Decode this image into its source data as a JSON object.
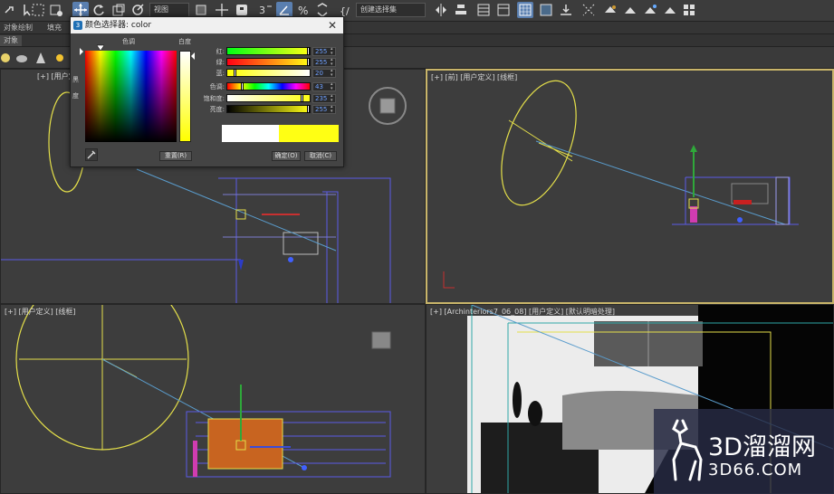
{
  "toolbar": {
    "view_dropdown": "视图",
    "selection_set_dropdown": "创建选择集"
  },
  "tabs": {
    "object_paint": "对象绘制",
    "populate": "填充",
    "objects": "对象"
  },
  "viewports": {
    "top_left": {
      "label": "[+] [用户定义] [线框]"
    },
    "front_right": {
      "label": "[+] [前] [用户定义] [线框]"
    },
    "left_bottom": {
      "label": "[+] [用户定义] [线框]"
    },
    "camera": {
      "label": "[+] [Archinteriors7_06_08] [用户定义] [默认明暗处理]"
    }
  },
  "color_dialog": {
    "title": "颜色选择器: color",
    "hue_label": "色调",
    "whiteness_label": "白度",
    "black_label": "黑",
    "degree_label": "度",
    "sliders": [
      {
        "label": "红:",
        "value": "255",
        "fraction": 1.0
      },
      {
        "label": "绿:",
        "value": "255",
        "fraction": 1.0
      },
      {
        "label": "蓝:",
        "value": "20",
        "fraction": 0.078
      },
      {
        "label": "色调:",
        "value": "43",
        "fraction": 0.169
      },
      {
        "label": "饱和度:",
        "value": "235",
        "fraction": 0.922
      },
      {
        "label": "亮度:",
        "value": "255",
        "fraction": 1.0
      }
    ],
    "reset_button": "重置(R)",
    "ok_button": "确定(O)",
    "cancel_button": "取消(C)",
    "old_color": "#ffffff",
    "new_color": "#ffff14"
  },
  "watermark": {
    "brand": "3D溜溜网",
    "url": "3D66.COM"
  },
  "colors": {
    "active_viewport_border": "#c9b56a",
    "selection_yellow": "#e5e04a",
    "wire_blue": "#5a5ae6"
  }
}
